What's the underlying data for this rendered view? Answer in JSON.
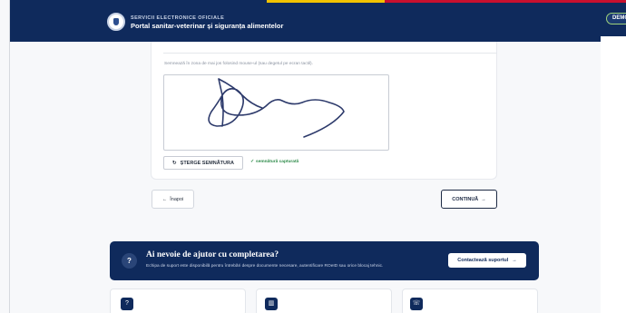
{
  "header": {
    "subtitle": "SERVICII ELECTRONICE OFICIALE",
    "title": "Portal sanitar-veterinar și siguranța alimentelor",
    "badge": "DEMO",
    "colors": {
      "navy": "#0f2a5c",
      "yellow": "#f2c200",
      "red": "#c8102e"
    }
  },
  "signature": {
    "hint": "Semnează în zona de mai jos folosind mouse-ul (sau degetul pe ecran tactil).",
    "clear_label": "ȘTERGE SEMNĂTURA",
    "clear_icon": "reset-icon",
    "status": "semnătură capturată",
    "status_icon": "check-icon"
  },
  "navigation": {
    "back_label": "Înapoi",
    "back_icon": "arrow-left-icon",
    "next_label": "CONTINUĂ",
    "next_icon": "arrow-right-icon"
  },
  "help": {
    "icon": "question-icon",
    "title": "Ai nevoie de ajutor cu completarea?",
    "text": "Echipa de suport este disponibilă pentru întrebări despre documente necesare, autentificare ROeID sau orice blocaj tehnic.",
    "button_label": "Contactează suportul",
    "button_icon": "arrow-right-icon"
  },
  "bottom_cards": [
    {
      "icon": "question-icon"
    },
    {
      "icon": "book-icon"
    },
    {
      "icon": "phone-icon"
    }
  ]
}
